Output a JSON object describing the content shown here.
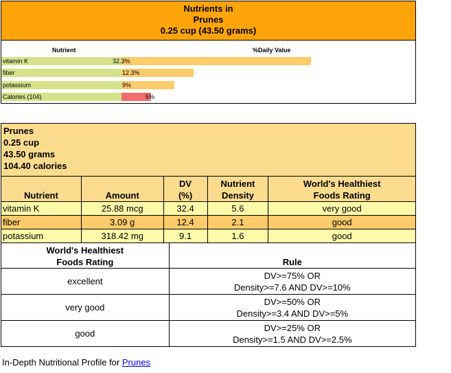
{
  "chart": {
    "title_line1": "Nutrients in",
    "title_line2": "Prunes",
    "title_line3": "0.25 cup (43.50 grams)",
    "col_nutrient": "Nutrient",
    "col_dv": "%Daily Value",
    "bars": [
      {
        "label": "vitamin K",
        "value_text": "32.3%",
        "percent": 32.3,
        "color": "#fbcb6c"
      },
      {
        "label": "fiber",
        "value_text": "12.3%",
        "percent": 12.3,
        "color": "#fbcb6c"
      },
      {
        "label": "potassium",
        "value_text": "9%",
        "percent": 9,
        "color": "#fbcb6c"
      },
      {
        "label": "Calories (104)",
        "value_text": "5%",
        "percent": 5,
        "color": "#f06e6e"
      }
    ]
  },
  "summary": {
    "food": "Prunes",
    "serving": "0.25 cup",
    "grams": "43.50 grams",
    "calories": "104.40 calories"
  },
  "table": {
    "headers": {
      "nutrient": "Nutrient",
      "amount": "Amount",
      "dv_line1": "DV",
      "dv_line2": "(%)",
      "density_line1": "Nutrient",
      "density_line2": "Density",
      "rating_line1": "World's Healthiest",
      "rating_line2": "Foods Rating"
    },
    "rows": [
      {
        "nutrient": "vitamin K",
        "amount": "25.88 mcg",
        "dv": "32.4",
        "density": "5.6",
        "rating": "very good"
      },
      {
        "nutrient": "fiber",
        "amount": "3.09 g",
        "dv": "12.4",
        "density": "2.1",
        "rating": "good"
      },
      {
        "nutrient": "potassium",
        "amount": "318.42 mg",
        "dv": "9.1",
        "density": "1.6",
        "rating": "good"
      }
    ]
  },
  "rules": {
    "header_rating_line1": "World's Healthiest",
    "header_rating_line2": "Foods Rating",
    "header_rule": "Rule",
    "rows": [
      {
        "rating": "excellent",
        "rule_line1": "DV>=75% OR",
        "rule_line2": "Density>=7.6 AND DV>=10%"
      },
      {
        "rating": "very good",
        "rule_line1": "DV>=50% OR",
        "rule_line2": "Density>=3.4 AND DV>=5%"
      },
      {
        "rating": "good",
        "rule_line1": "DV>=25% OR",
        "rule_line2": "Density>=1.5 AND DV>=2.5%"
      }
    ]
  },
  "footer": {
    "text": "In-Depth Nutritional Profile for ",
    "link": "Prunes"
  }
}
